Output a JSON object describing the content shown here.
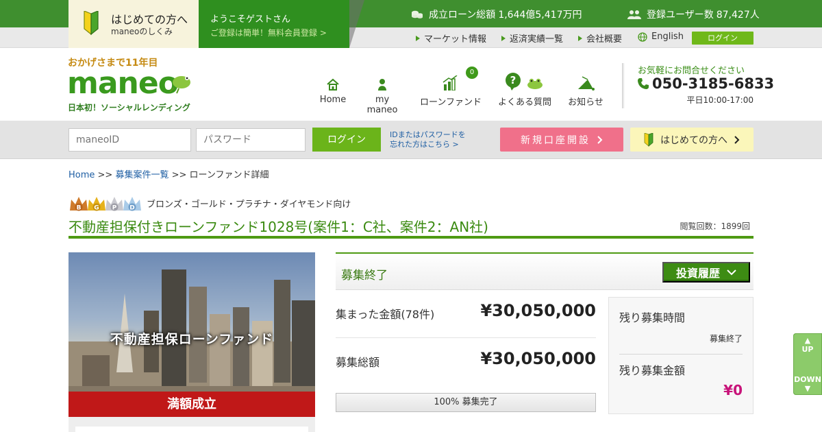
{
  "topbar": {
    "beginner": {
      "title": "はじめての方へ",
      "subtitle": "maneoのしくみ"
    },
    "welcome": {
      "greeting": "ようこそゲストさん",
      "register": "ご登録は簡単！無料会員登録 >"
    },
    "stats": {
      "loans_label": "成立ローン総額",
      "loans_value": "1,644億5,417万円",
      "users_label": "登録ユーザー数",
      "users_value": "87,427人"
    },
    "subnav": [
      "マーケット情報",
      "返済実績一覧",
      "会社概要",
      "English"
    ],
    "login_label": "ログイン"
  },
  "header": {
    "tagline": "おかげさまで11年目",
    "logo_text": "maneo",
    "logo_sub": "日本初！ソーシャルレンディング",
    "nav": [
      {
        "label": "Home",
        "icon": "home-icon"
      },
      {
        "label": "my maneo",
        "icon": "person-icon"
      },
      {
        "label": "ローンファンド",
        "icon": "chart-icon",
        "badge": "0"
      },
      {
        "label": "よくある質問",
        "icon": "question-icon"
      },
      {
        "label": "お知らせ",
        "icon": "bell-icon"
      }
    ],
    "contact": {
      "lead": "お気軽にお問合せください",
      "tel": "050-3185-6833",
      "hours": "平日10:00-17:00"
    }
  },
  "loginbar": {
    "id_placeholder": "maneoID",
    "pw_placeholder": "パスワード",
    "login_label": "ログイン",
    "forgot_line1": "IDまたはパスワードを",
    "forgot_line2": "忘れた方はこちら >",
    "open_account": "新規口座開設",
    "beginner": "はじめての方へ"
  },
  "breadcrumb": {
    "home": "Home",
    "sep": " >> ",
    "list": "募集案件一覧",
    "current": "ローンファンド詳細"
  },
  "fund": {
    "target": "ブロンズ・ゴールド・プラチナ・ダイヤモンド向け",
    "crowns": [
      "B",
      "G",
      "P",
      "D"
    ],
    "title": "不動産担保付きローンファンド1028号(案件1：C社、案件2：AN社)",
    "views_label": "閲覧回数：",
    "views": "1899回",
    "image_caption": "不動産担保ローンファンド",
    "image_band": "満額成立",
    "status": "募集終了",
    "history_button": "投資履歴",
    "collected_label": "集まった金額(78件)",
    "collected_value": "¥30,050,000",
    "total_label": "募集総額",
    "total_value": "¥30,050,000",
    "progress_percent": 100,
    "progress_text": "100% 募集完了",
    "remaining_time_label": "残り募集時間",
    "remaining_time_value": "募集終了",
    "remaining_amount_label": "残り募集金額",
    "remaining_amount_value": "¥0"
  },
  "scroll": {
    "up": "UP",
    "down": "DOWN"
  },
  "colors": {
    "brand_green": "#3f8f2f",
    "accent_pink": "#f0708a",
    "remaining_magenta": "#c8147a",
    "sold_out_red": "#c01818"
  }
}
